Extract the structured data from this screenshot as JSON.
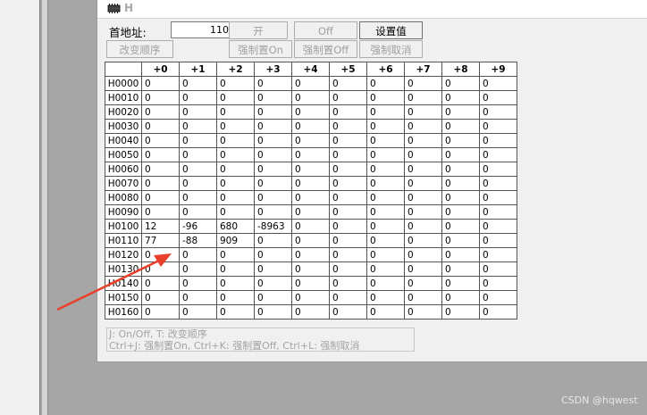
{
  "window": {
    "title": "H"
  },
  "form": {
    "addr_label": "首地址:",
    "addr_value": "110",
    "btn_open": "开",
    "btn_off": "Off",
    "btn_setvalue": "设置值",
    "btn_change_order": "改变顺序",
    "btn_force_on": "强制置On",
    "btn_force_off": "强制置Off",
    "btn_force_cancel": "强制取消"
  },
  "table": {
    "columns": [
      "+0",
      "+1",
      "+2",
      "+3",
      "+4",
      "+5",
      "+6",
      "+7",
      "+8",
      "+9"
    ],
    "rows": [
      {
        "addr": "H0000",
        "values": [
          "0",
          "0",
          "0",
          "0",
          "0",
          "0",
          "0",
          "0",
          "0",
          "0"
        ]
      },
      {
        "addr": "H0010",
        "values": [
          "0",
          "0",
          "0",
          "0",
          "0",
          "0",
          "0",
          "0",
          "0",
          "0"
        ]
      },
      {
        "addr": "H0020",
        "values": [
          "0",
          "0",
          "0",
          "0",
          "0",
          "0",
          "0",
          "0",
          "0",
          "0"
        ]
      },
      {
        "addr": "H0030",
        "values": [
          "0",
          "0",
          "0",
          "0",
          "0",
          "0",
          "0",
          "0",
          "0",
          "0"
        ]
      },
      {
        "addr": "H0040",
        "values": [
          "0",
          "0",
          "0",
          "0",
          "0",
          "0",
          "0",
          "0",
          "0",
          "0"
        ]
      },
      {
        "addr": "H0050",
        "values": [
          "0",
          "0",
          "0",
          "0",
          "0",
          "0",
          "0",
          "0",
          "0",
          "0"
        ]
      },
      {
        "addr": "H0060",
        "values": [
          "0",
          "0",
          "0",
          "0",
          "0",
          "0",
          "0",
          "0",
          "0",
          "0"
        ]
      },
      {
        "addr": "H0070",
        "values": [
          "0",
          "0",
          "0",
          "0",
          "0",
          "0",
          "0",
          "0",
          "0",
          "0"
        ]
      },
      {
        "addr": "H0080",
        "values": [
          "0",
          "0",
          "0",
          "0",
          "0",
          "0",
          "0",
          "0",
          "0",
          "0"
        ]
      },
      {
        "addr": "H0090",
        "values": [
          "0",
          "0",
          "0",
          "0",
          "0",
          "0",
          "0",
          "0",
          "0",
          "0"
        ]
      },
      {
        "addr": "H0100",
        "values": [
          "12",
          "-96",
          "680",
          "-8963",
          "0",
          "0",
          "0",
          "0",
          "0",
          "0"
        ]
      },
      {
        "addr": "H0110",
        "values": [
          "77",
          "-88",
          "909",
          "0",
          "0",
          "0",
          "0",
          "0",
          "0",
          "0"
        ]
      },
      {
        "addr": "H0120",
        "values": [
          "0",
          "0",
          "0",
          "0",
          "0",
          "0",
          "0",
          "0",
          "0",
          "0"
        ]
      },
      {
        "addr": "H0130",
        "values": [
          "0",
          "0",
          "0",
          "0",
          "0",
          "0",
          "0",
          "0",
          "0",
          "0"
        ]
      },
      {
        "addr": "H0140",
        "values": [
          "0",
          "0",
          "0",
          "0",
          "0",
          "0",
          "0",
          "0",
          "0",
          "0"
        ]
      },
      {
        "addr": "H0150",
        "values": [
          "0",
          "0",
          "0",
          "0",
          "0",
          "0",
          "0",
          "0",
          "0",
          "0"
        ]
      },
      {
        "addr": "H0160",
        "values": [
          "0",
          "0",
          "0",
          "0",
          "0",
          "0",
          "0",
          "0",
          "0",
          "0"
        ]
      }
    ]
  },
  "help": {
    "line1": "J: On/Off,   T: 改变顺序",
    "line2": "Ctrl+J: 强制置On,   Ctrl+K:  强制置Off,   Ctrl+L: 强制取消"
  },
  "watermark": "CSDN @hqwest",
  "colors": {
    "annotation_arrow": "#e8402a"
  }
}
